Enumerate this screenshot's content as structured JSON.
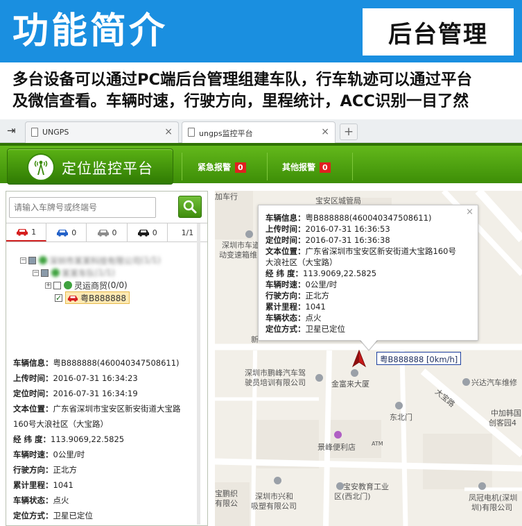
{
  "banner": {
    "title": "功能简介",
    "box_label": "后台管理",
    "desc_line1": "多台设备可以通过PC端后台管理组建车队，行车轨迹可以通过平台",
    "desc_line2": "及微信查看。车辆时速，行驶方向，里程统计，ACC识别一目了然",
    "bg_color": "#1a8fe0"
  },
  "browser": {
    "tabs": [
      {
        "title": "UNGPS",
        "active": false
      },
      {
        "title": "ungps监控平台",
        "active": true
      }
    ],
    "back_icon": "back-arrow-icon",
    "close_glyph": "×",
    "new_tab_glyph": "+"
  },
  "header": {
    "app_title": "定位监控平台",
    "alarms": [
      {
        "label": "紧急报警",
        "count": "0"
      },
      {
        "label": "其他报警",
        "count": "0"
      }
    ],
    "accent": "#4a9e10"
  },
  "search": {
    "placeholder": "请输入车牌号或终端号",
    "button_icon": "search-icon"
  },
  "car_status_tabs": [
    {
      "icon": "red-car-icon",
      "color": "#d62020",
      "count": "1"
    },
    {
      "icon": "blue-car-icon",
      "color": "#2462c8",
      "count": "0"
    },
    {
      "icon": "gray-car-icon",
      "color": "#8c8c8c",
      "count": "0"
    },
    {
      "icon": "black-car-icon",
      "color": "#1c1c1c",
      "count": "0"
    },
    {
      "icon": "page-indicator",
      "label": "1/1"
    }
  ],
  "tree": {
    "group1": {
      "count": "(1/1)"
    },
    "group2": {
      "count": "(1/1)"
    },
    "subgroup": {
      "label": "灵运商贸",
      "count": "(0/0)"
    },
    "vehicle": {
      "plate": "粤B888888"
    }
  },
  "left_info": [
    {
      "key": "车辆信息：",
      "value": "粤B888888(460040347508611)"
    },
    {
      "key": "上传时间：",
      "value": "2016-07-31 16:34:23"
    },
    {
      "key": "定位时间：",
      "value": "2016-07-31 16:34:19"
    },
    {
      "key": "文本位置：",
      "value": "广东省深圳市宝安区新安街道大宝路"
    },
    {
      "key": "",
      "value": "160号大浪社区（大宝路）"
    },
    {
      "key": "经 纬 度：",
      "value": "113.9069,22.5825"
    },
    {
      "key": "车辆时速：",
      "value": "0公里/时"
    },
    {
      "key": "行驶方向：",
      "value": "正北方"
    },
    {
      "key": "累计里程：",
      "value": "1041"
    },
    {
      "key": "车辆状态：",
      "value": "点火"
    },
    {
      "key": "定位方式：",
      "value": "卫星已定位"
    }
  ],
  "popup": {
    "close_glyph": "×",
    "rows": [
      {
        "key": "车辆信息：",
        "value": "粤B888888(460040347508611)"
      },
      {
        "key": "上传时间：",
        "value": "2016-07-31 16:36:53"
      },
      {
        "key": "定位时间：",
        "value": "2016-07-31 16:36:38"
      },
      {
        "key": "文本位置：",
        "value": "广东省深圳市宝安区新安街道大宝路160号"
      },
      {
        "key": "",
        "value": "大浪社区（大宝路）"
      },
      {
        "key": "经 纬 度：",
        "value": "113.9069,22.5825"
      },
      {
        "key": "车辆时速：",
        "value": "0公里/时"
      },
      {
        "key": "行驶方向：",
        "value": "正北方"
      },
      {
        "key": "累计里程：",
        "value": "1041"
      },
      {
        "key": "车辆状态：",
        "value": "点火"
      },
      {
        "key": "定位方式：",
        "value": "卫星已定位"
      }
    ]
  },
  "map": {
    "vehicle_tag": "粤B888888 [0km/h]",
    "labels": {
      "l1": "加车行",
      "l2": "宝安区城管局",
      "l3": "深圳市车道",
      "l4": "动变速箱维",
      "l5": "新",
      "l6": "深圳市鹏峰汽车驾",
      "l7": "驶员培训有限公司",
      "l8": "金富来大厦",
      "l9": "兴达汽车维修",
      "l10": "大宝路",
      "l11": "东北门",
      "l12": "中加韩国",
      "l13": "创客园4",
      "l14": "景峰便利店",
      "l15": "宝安教育工业",
      "l16": "区(西北门)",
      "l17": "宝鹏织",
      "l18": "有限公",
      "l19": "深圳市兴和",
      "l20": "吸塑有限公司",
      "l21": "凤冠电机(深圳",
      "l22": "圳)有限公司",
      "atm": "ATM"
    }
  }
}
